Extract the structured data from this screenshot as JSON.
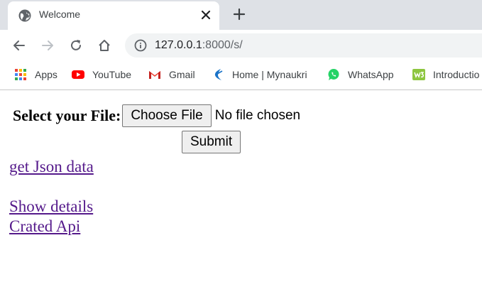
{
  "browser": {
    "tab": {
      "title": "Welcome",
      "icon": "globe-icon"
    },
    "toolbar": {
      "url_host": "127.0.0.1",
      "url_rest": ":8000/s/"
    },
    "bookmarks": [
      {
        "label": "Apps",
        "icon": "apps-grid-icon"
      },
      {
        "label": "YouTube",
        "icon": "youtube-icon"
      },
      {
        "label": "Gmail",
        "icon": "gmail-icon"
      },
      {
        "label": "Home | Mynaukri",
        "icon": "mynaukri-icon"
      },
      {
        "label": "WhatsApp",
        "icon": "whatsapp-icon"
      },
      {
        "label": "Introductio",
        "icon": "w3-icon"
      }
    ]
  },
  "page": {
    "file_label": "Select your File:",
    "choose_file_label": "Choose File",
    "no_file_text": "No file chosen",
    "submit_label": "Submit",
    "links": [
      "get Json data",
      "Show details",
      "Crated Api"
    ]
  },
  "colors": {
    "tabstrip": "#dee1e6",
    "omnibox": "#f1f3f4",
    "visited_link": "#551a8b"
  }
}
